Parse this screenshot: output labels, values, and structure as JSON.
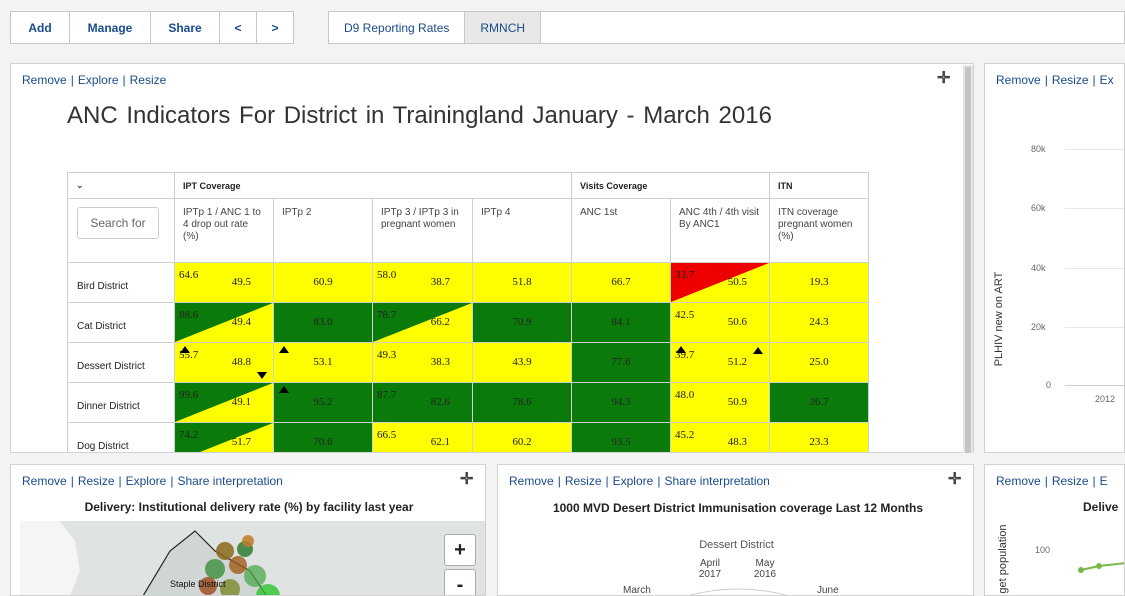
{
  "toolbar": {
    "add": "Add",
    "manage": "Manage",
    "share": "Share",
    "prev": "<",
    "next": ">"
  },
  "tabs": [
    "D9 Reporting Rates",
    "RMNCH"
  ],
  "panel_main": {
    "links": [
      "Remove",
      "Explore",
      "Resize"
    ],
    "title": "ANC Indicators   For  District in  Trainingland     January - March 2016",
    "search_placeholder": "Search for",
    "groups": [
      "IPT Coverage",
      "Visits Coverage",
      "ITN"
    ],
    "columns": [
      "IPTp 1 / ANC 1 to 4 drop out rate (%)",
      "IPTp 2",
      "IPTp 3 / IPTp 3 in pregnant women",
      "IPTp 4",
      "ANC 1st",
      "ANC 4th / 4th visit By ANC1",
      "ITN coverage pregnant women (%)"
    ],
    "rows": [
      {
        "name": "Bird District",
        "cells": [
          {
            "a": "64.6",
            "b": "49.5",
            "c1": "yellow",
            "c2": "yellow"
          },
          {
            "v": "60.9",
            "c": "yellow"
          },
          {
            "a": "58.0",
            "b": "38.7",
            "c1": "yellow",
            "c2": "yellow"
          },
          {
            "v": "51.8",
            "c": "yellow"
          },
          {
            "v": "66.7",
            "c": "yellow"
          },
          {
            "a": "33.7",
            "b": "50.5",
            "c1": "red",
            "c2": "yellow"
          },
          {
            "v": "19.3",
            "c": "yellow"
          }
        ]
      },
      {
        "name": "Cat District",
        "cells": [
          {
            "a": "88.6",
            "b": "49.4",
            "c1": "green",
            "c2": "yellow"
          },
          {
            "v": "83.0",
            "c": "green"
          },
          {
            "a": "78.7",
            "b": "66.2",
            "c1": "green",
            "c2": "yellow"
          },
          {
            "v": "70.9",
            "c": "green"
          },
          {
            "v": "84.1",
            "c": "green"
          },
          {
            "a": "42.5",
            "b": "50.6",
            "c1": "yellow",
            "c2": "yellow"
          },
          {
            "v": "24.3",
            "c": "yellow"
          }
        ]
      },
      {
        "name": "Dessert District",
        "cells": [
          {
            "a": "55.7",
            "b": "48.8",
            "c1": "yellow",
            "c2": "yellow",
            "up": true,
            "down": true
          },
          {
            "v": "53.1",
            "c": "yellow",
            "up": true
          },
          {
            "a": "49.3",
            "b": "38.3",
            "c1": "yellow",
            "c2": "yellow"
          },
          {
            "v": "43.9",
            "c": "yellow"
          },
          {
            "v": "77.6",
            "c": "green"
          },
          {
            "a": "39.7",
            "b": "51.2",
            "c1": "yellow",
            "c2": "yellow",
            "up": true,
            "up2": true
          },
          {
            "v": "25.0",
            "c": "yellow"
          }
        ]
      },
      {
        "name": "Dinner District",
        "cells": [
          {
            "a": "99.6",
            "b": "49.1",
            "c1": "green",
            "c2": "yellow"
          },
          {
            "v": "95.2",
            "c": "green",
            "up": true
          },
          {
            "a": "87.7",
            "b": "82.6",
            "c1": "green",
            "c2": "green"
          },
          {
            "v": "78.6",
            "c": "green"
          },
          {
            "v": "94.3",
            "c": "green"
          },
          {
            "a": "48.0",
            "b": "50.9",
            "c1": "yellow",
            "c2": "yellow"
          },
          {
            "v": "26.7",
            "c": "green"
          }
        ]
      },
      {
        "name": "Dog District",
        "cells": [
          {
            "a": "74.2",
            "b": "51.7",
            "c1": "green",
            "c2": "yellow"
          },
          {
            "v": "70.6",
            "c": "green"
          },
          {
            "a": "66.5",
            "b": "62.1",
            "c1": "yellow",
            "c2": "yellow"
          },
          {
            "v": "60.2",
            "c": "yellow"
          },
          {
            "v": "93.5",
            "c": "green"
          },
          {
            "a": "45.2",
            "b": "48.3",
            "c1": "yellow",
            "c2": "yellow"
          },
          {
            "v": "23.3",
            "c": "yellow"
          }
        ]
      }
    ]
  },
  "panel_right_top": {
    "links": [
      "Remove",
      "Resize",
      "Ex"
    ],
    "ylabel": "PLHIV new on ART",
    "yticks": [
      "80k",
      "60k",
      "40k",
      "20k",
      "0"
    ],
    "xtick": "2012"
  },
  "panel_bl": {
    "links": [
      "Remove",
      "Resize",
      "Explore",
      "Share interpretation"
    ],
    "title": "Delivery: Institutional delivery rate (%) by facility last year",
    "map_label": "Staple District",
    "zoom_in": "+",
    "zoom_out": "-"
  },
  "panel_bm": {
    "links": [
      "Remove",
      "Resize",
      "Explore",
      "Share interpretation"
    ],
    "title": "1000 MVD Desert District Immunisation coverage Last 12 Months",
    "subtitle": "Dessert District",
    "labels": {
      "april": "April 2017",
      "may": "May 2016",
      "march": "March",
      "june": "June"
    }
  },
  "panel_br": {
    "links": [
      "Remove",
      "Resize",
      "E"
    ],
    "title": "Delive",
    "ylabel": "get population",
    "ytick": "100"
  },
  "colors": {
    "green": "#0a7a0a",
    "yellow": "#ffff00",
    "red": "#ee0000",
    "link": "#1a4b8c"
  }
}
